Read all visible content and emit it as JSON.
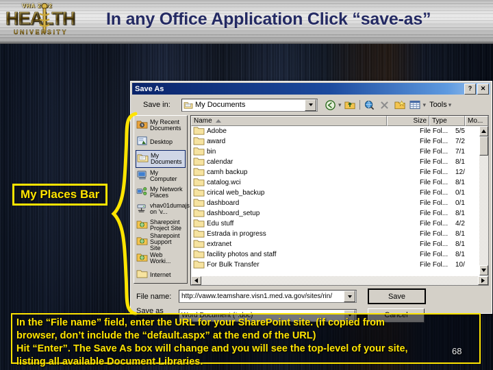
{
  "slide": {
    "title": "In any Office Application Click “save-as”",
    "page_number": "68",
    "colors": {
      "title": "#242a63",
      "annotation": "#ffe400",
      "titlebar": "#0a246a"
    }
  },
  "logo": {
    "top_text": "VHA 2002",
    "main_text": "HEALTH",
    "sub_text": "UNIVERSITY"
  },
  "dialog": {
    "title": "Save As",
    "help_button": "?",
    "close_button": "✕",
    "save_in": {
      "label": "Save in:",
      "value": "My Documents"
    },
    "toolbar": {
      "tools_label": "Tools",
      "items": [
        "back-icon",
        "up-one-level-icon",
        "search-web-icon",
        "delete-icon",
        "new-folder-icon",
        "views-icon"
      ]
    },
    "places_bar": {
      "items": [
        {
          "label": "My Recent Documents",
          "icon": "recent-documents-icon",
          "selected": false
        },
        {
          "label": "Desktop",
          "icon": "desktop-icon",
          "selected": false
        },
        {
          "label": "My Documents",
          "icon": "my-documents-icon",
          "selected": true
        },
        {
          "label": "My Computer",
          "icon": "my-computer-icon",
          "selected": false
        },
        {
          "label": "My Network Places",
          "icon": "network-places-icon",
          "selected": false
        },
        {
          "label": "vhav01dumajs on 'v...",
          "icon": "network-drive-icon",
          "selected": false
        },
        {
          "label": "Sharepoint Project Site",
          "icon": "web-folder-icon",
          "selected": false
        },
        {
          "label": "Sharepoint Support Site",
          "icon": "web-folder-icon",
          "selected": false
        },
        {
          "label": "Web Worki...",
          "icon": "web-folder-icon",
          "selected": false
        },
        {
          "label": "Internet",
          "icon": "folder-icon",
          "selected": false
        }
      ]
    },
    "file_list": {
      "columns": [
        "Name",
        "Size",
        "Type",
        "Mo..."
      ],
      "sort_column": "Name",
      "sort_direction": "ascending",
      "rows": [
        {
          "name": "Adobe",
          "size": "",
          "type": "File Fol...",
          "modified": "5/5"
        },
        {
          "name": "award",
          "size": "",
          "type": "File Fol...",
          "modified": "7/2"
        },
        {
          "name": "bin",
          "size": "",
          "type": "File Fol...",
          "modified": "7/1"
        },
        {
          "name": "calendar",
          "size": "",
          "type": "File Fol...",
          "modified": "8/1"
        },
        {
          "name": "camh backup",
          "size": "",
          "type": "File Fol...",
          "modified": "12/"
        },
        {
          "name": "catalog.wci",
          "size": "",
          "type": "File Fol...",
          "modified": "8/1"
        },
        {
          "name": "cirical web_backup",
          "size": "",
          "type": "File Fol...",
          "modified": "0/1"
        },
        {
          "name": "dashboard",
          "size": "",
          "type": "File Fol...",
          "modified": "0/1"
        },
        {
          "name": "dashboard_setup",
          "size": "",
          "type": "File Fol...",
          "modified": "8/1"
        },
        {
          "name": "Edu stuff",
          "size": "",
          "type": "File Fol...",
          "modified": "4/2"
        },
        {
          "name": "Estrada in progress",
          "size": "",
          "type": "File Fol...",
          "modified": "8/1"
        },
        {
          "name": "extranet",
          "size": "",
          "type": "File Fol...",
          "modified": "8/1"
        },
        {
          "name": "facility photos and staff",
          "size": "",
          "type": "File Fol...",
          "modified": "8/1"
        },
        {
          "name": "For Bulk Transfer",
          "size": "",
          "type": "File Fol...",
          "modified": "10/"
        }
      ]
    },
    "file_name": {
      "label": "File name:",
      "value": "http://vaww.teamshare.visn1.med.va.gov/sites/rin/"
    },
    "save_as_type": {
      "label": "Save as type:",
      "value": "Word Document (*.doc)"
    },
    "buttons": {
      "save": "Save",
      "cancel": "Cancel"
    }
  },
  "annotations": {
    "places_callout": "My Places Bar",
    "caption_lines": [
      "In the “File name” field, enter the URL for your SharePoint site. (if copied from",
      "browser, don’t include the “default.aspx” at the end of the URL)",
      "Hit “Enter”. The Save As box will change and you will see the top-level of your site,",
      "listing all available Document Libraries."
    ]
  }
}
